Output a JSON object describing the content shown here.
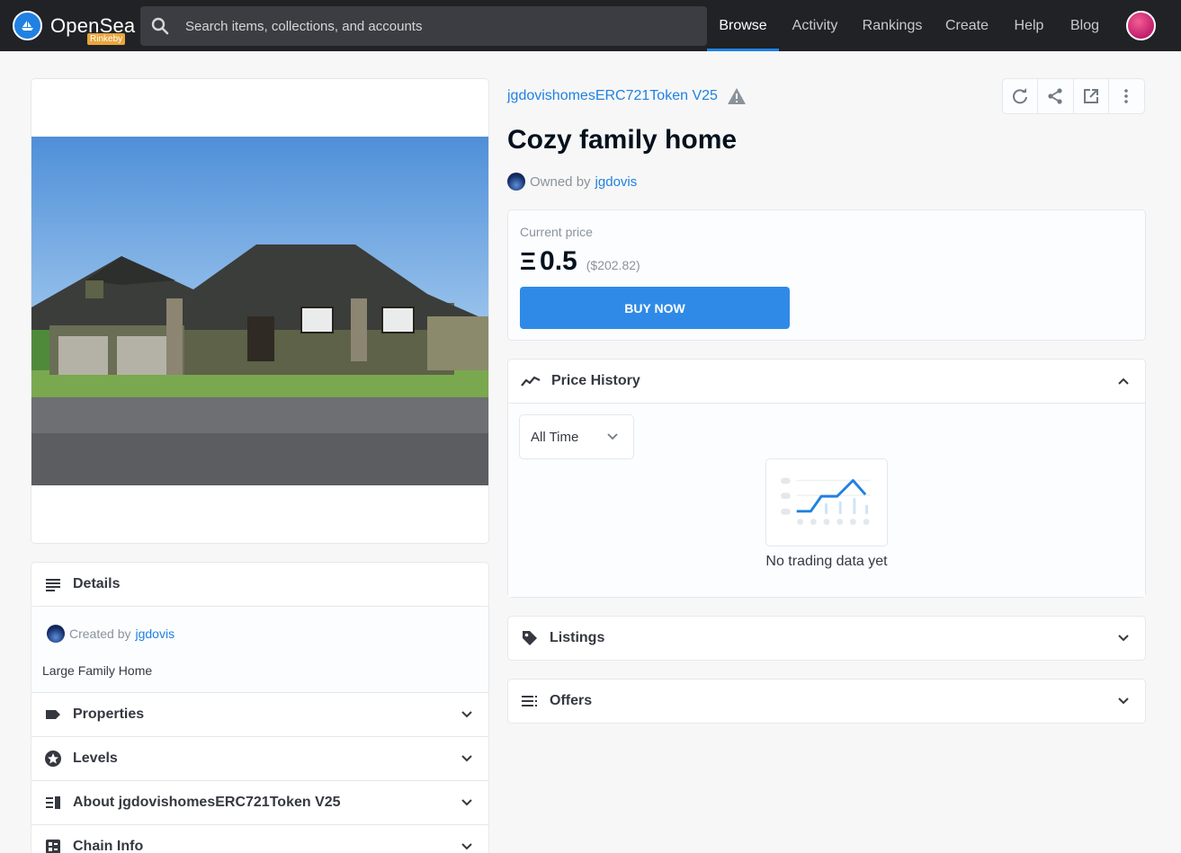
{
  "nav": {
    "brand": "OpenSea",
    "network_tag": "Rinkeby",
    "search_placeholder": "Search items, collections, and accounts",
    "links": [
      "Browse",
      "Activity",
      "Rankings",
      "Create",
      "Help",
      "Blog"
    ],
    "active_link": "Browse",
    "accent_color": "#2081e2"
  },
  "asset": {
    "collection": "jgdovishomesERC721Token V25",
    "name": "Cozy family home",
    "owned_by_label": "Owned by",
    "owner": "jgdovis"
  },
  "price": {
    "label": "Current price",
    "currency_symbol": "Ξ",
    "value": "0.5",
    "usd": "($202.82)",
    "buy_label": "BUY NOW"
  },
  "price_history": {
    "title": "Price History",
    "range_selected": "All Time",
    "empty_text": "No trading data yet"
  },
  "listings": {
    "title": "Listings"
  },
  "offers": {
    "title": "Offers"
  },
  "details": {
    "title": "Details",
    "created_by_label": "Created by",
    "creator": "jgdovis",
    "description": "Large Family Home"
  },
  "accordions": {
    "properties": "Properties",
    "levels": "Levels",
    "about": "About jgdovishomesERC721Token V25",
    "chain_info": "Chain Info"
  },
  "icons": {
    "toolbar": [
      "refresh-icon",
      "share-icon",
      "external-link-icon",
      "more-icon"
    ]
  }
}
